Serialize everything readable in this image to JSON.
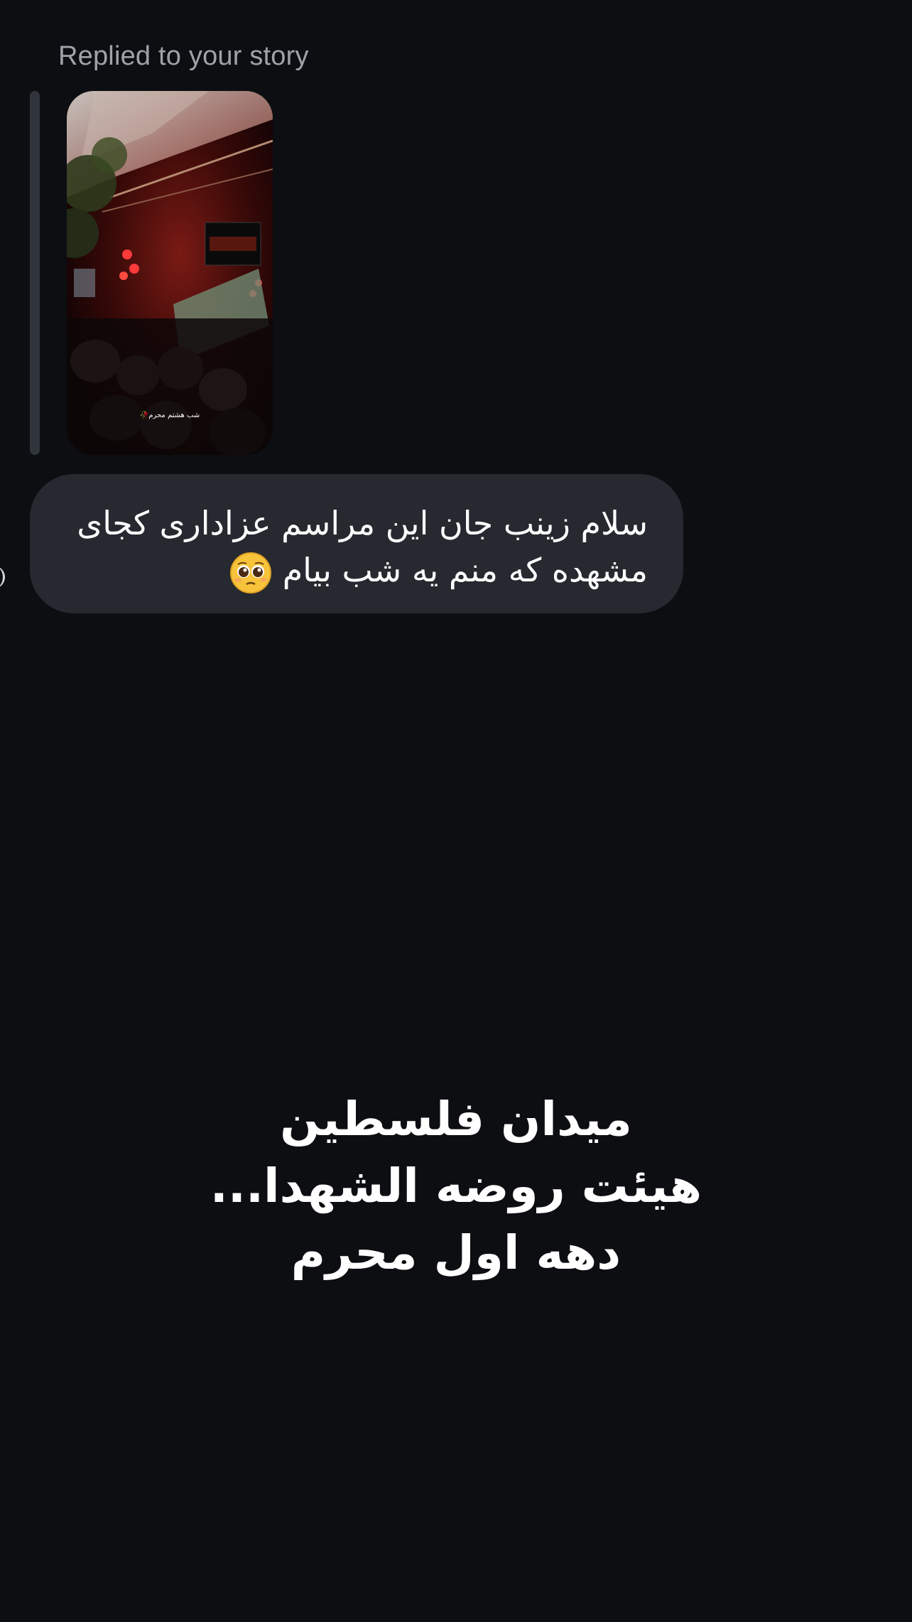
{
  "reply": {
    "caption": "Replied to your story",
    "story_overlay_text": "شب هشتم محرم🥀"
  },
  "message": {
    "lines": [
      "سلام زینب جان این مراسم عزاداری کجای",
      "مشهده که منم یه شب بیام"
    ],
    "emoji": "pleading-face-emoji"
  },
  "story_text": {
    "lines": [
      "میدان فلسطین",
      "هیئت روضه الشهدا...",
      "دهه اول محرم"
    ]
  },
  "colors": {
    "background": "#0c0e12",
    "bubble": "#26292f",
    "caption": "#9ea3aa",
    "reply_bar": "#30343b"
  }
}
